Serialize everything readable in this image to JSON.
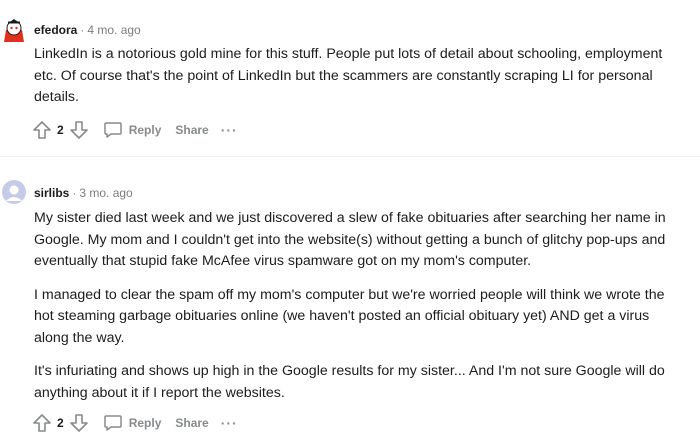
{
  "comments": [
    {
      "author": "efedora",
      "separator": "·",
      "time": "4 mo. ago",
      "paragraphs": [
        "LinkedIn is a notorious gold mine for this stuff. People put lots of detail about schooling, employment etc. Of course that's the point of LinkedIn but the scammers are constantly scraping LI for personal details."
      ],
      "score": "2",
      "reply_label": "Reply",
      "share_label": "Share",
      "more_label": "···"
    },
    {
      "author": "sirlibs",
      "separator": "·",
      "time": "3 mo. ago",
      "paragraphs": [
        "My sister died last week and we just discovered a slew of fake obituaries after searching her name in Google. My mom and I couldn't get into the website(s) without getting a bunch of glitchy pop-ups and eventually that stupid fake McAfee virus spamware got on my mom's computer.",
        "I managed to clear the spam off my mom's computer but we're worried people will think we wrote the hot steaming garbage obituaries online (we haven't posted an official obituary yet) AND get a virus along the way.",
        "It's infuriating and shows up high in the Google results for my sister... And I'm not sure Google will do anything about it if I report the websites."
      ],
      "score": "2",
      "reply_label": "Reply",
      "share_label": "Share",
      "more_label": "···"
    }
  ],
  "colors": {
    "text": "#1c1c1c",
    "muted": "#7c7c7c",
    "action": "#878a8c",
    "avatar1": "#e0301e",
    "avatar2": "#c5cbe8"
  }
}
